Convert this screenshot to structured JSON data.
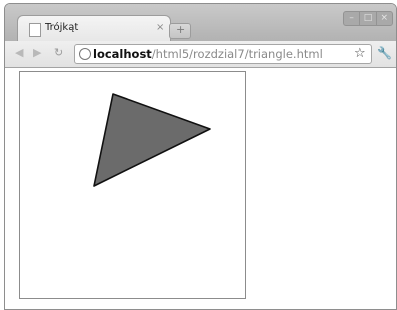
{
  "tab": {
    "title": "Trójkąt",
    "close_glyph": "×",
    "favicon": "page-icon"
  },
  "new_tab": {
    "icon": "new-tab-icon",
    "glyph": "+"
  },
  "window_controls": {
    "minimize": "–",
    "maximize": "□",
    "close": "×"
  },
  "toolbar": {
    "back_glyph": "◀",
    "forward_glyph": "▶",
    "reload_glyph": "↻",
    "star_glyph": "☆",
    "wrench_glyph": "🔧"
  },
  "address": {
    "host": "localhost",
    "path": "/html5/rozdzial7/triangle.html"
  },
  "canvas": {
    "shape": "triangle",
    "fill": "#6b6b6b",
    "stroke": "#111111"
  }
}
